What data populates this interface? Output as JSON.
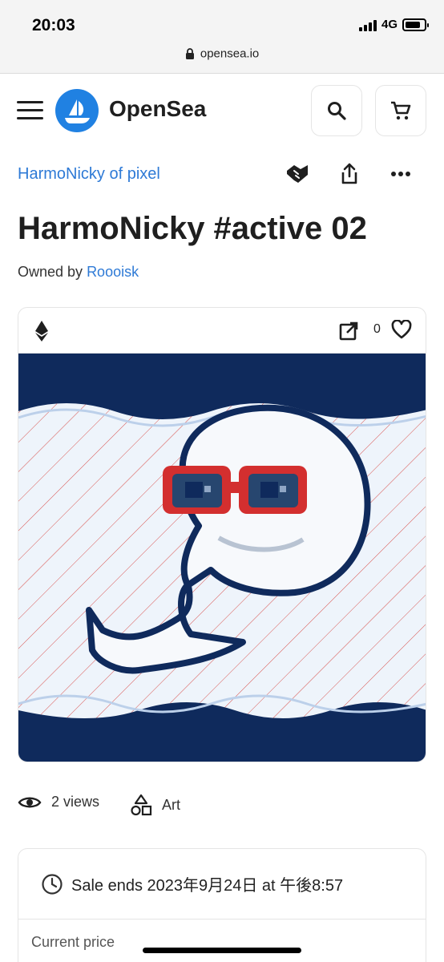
{
  "status_bar": {
    "time": "20:03",
    "network": "4G"
  },
  "browser": {
    "url": "opensea.io"
  },
  "header": {
    "brand": "OpenSea",
    "icons": [
      "menu-icon",
      "opensea-logo",
      "search-icon",
      "cart-icon"
    ]
  },
  "item": {
    "collection": "HarmoNicky of pixel",
    "title": "HarmoNicky #active 02",
    "owned_by_label": "Owned by",
    "owner": "Roooisk",
    "actions": [
      "offer-icon",
      "share-icon",
      "more-icon"
    ],
    "likes": "0",
    "views": "2 views",
    "category": "Art"
  },
  "sale": {
    "ends": "Sale ends 2023年9月24日 at 午後8:57",
    "price_label": "Current price"
  },
  "colors": {
    "accent": "#2081e2",
    "link": "#2e7ad6",
    "navy": "#0f2a5c",
    "red": "#d32f2f"
  }
}
